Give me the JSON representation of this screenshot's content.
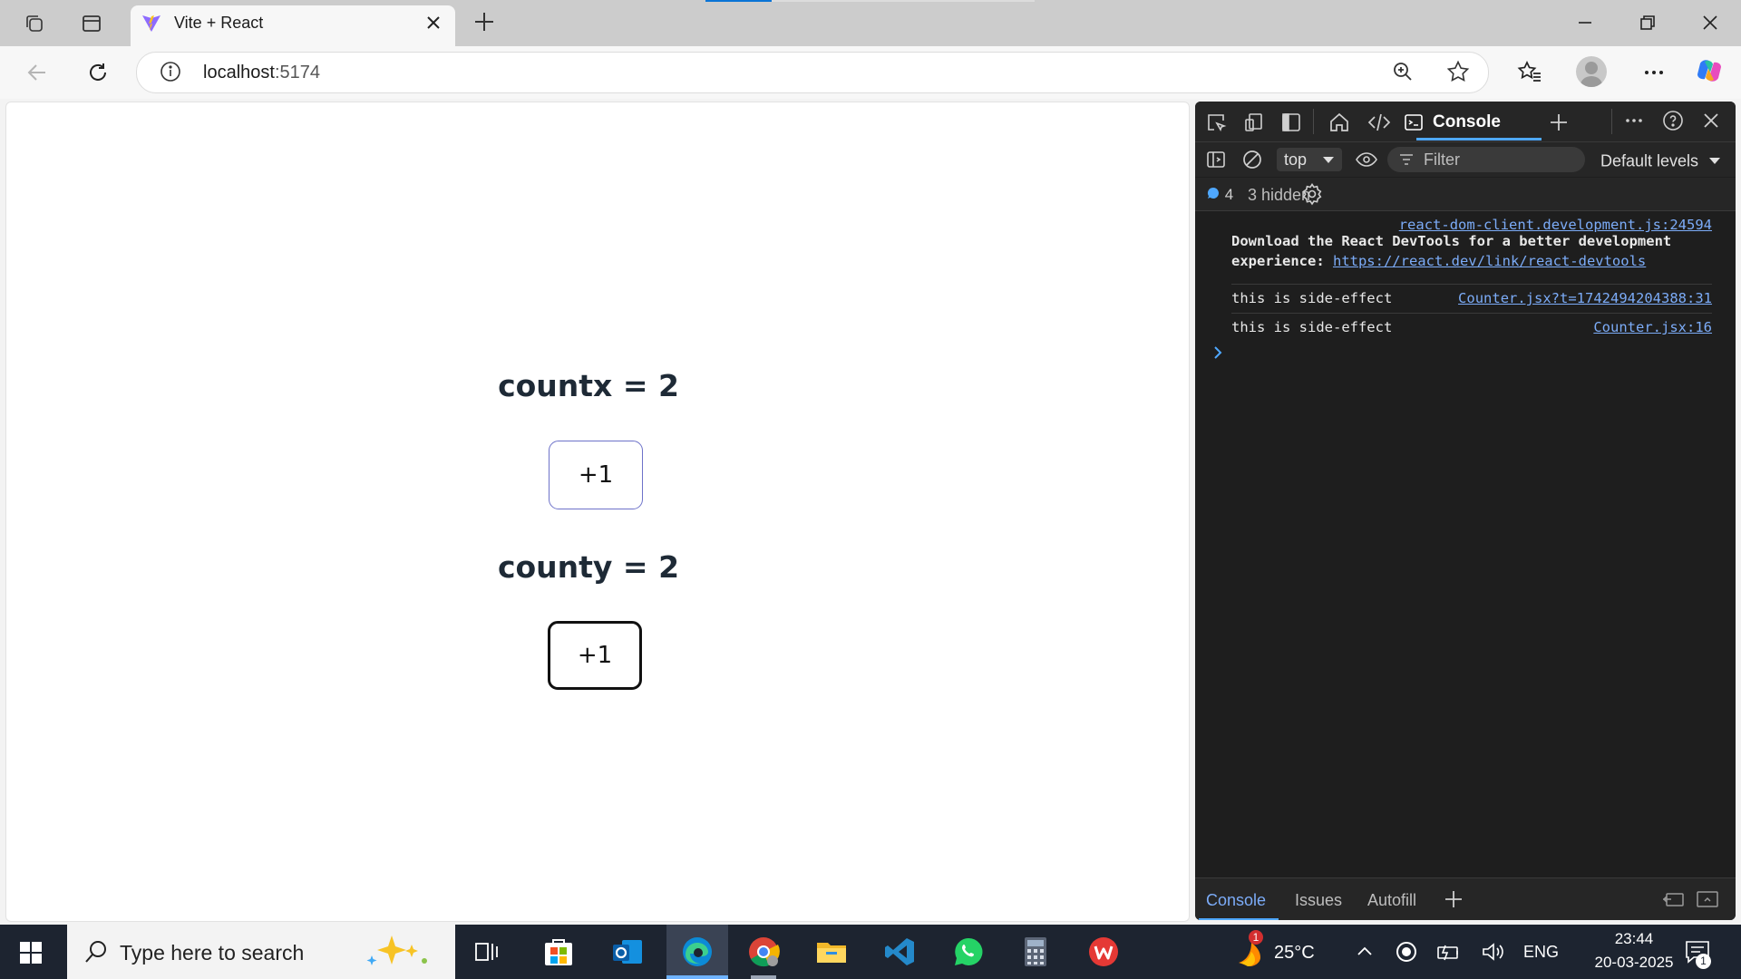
{
  "browser": {
    "tab": {
      "title": "Vite + React"
    },
    "address": {
      "host": "localhost",
      "port": ":5174"
    }
  },
  "page": {
    "countx": {
      "label": "countx = 2",
      "button": "+1"
    },
    "county": {
      "label": "county = 2",
      "button": "+1"
    }
  },
  "devtools": {
    "active_tab": "Console",
    "context": "top",
    "filter_placeholder": "Filter",
    "levels": "Default levels",
    "message_count": "4",
    "hidden": "3 hidden",
    "logs": [
      {
        "source": "react-dom-client.development.js:24594",
        "line1": "Download the React DevTools for a better development",
        "line2_prefix": "experience: ",
        "link": "https://react.dev/link/react-devtools"
      },
      {
        "text": "this is side-effect",
        "source": "Counter.jsx?t=1742494204388:31"
      },
      {
        "text": "this is side-effect",
        "source": "Counter.jsx:16"
      }
    ],
    "drawer_tabs": [
      "Console",
      "Issues",
      "Autofill"
    ]
  },
  "taskbar": {
    "search_placeholder": "Type here to search",
    "weather": "25°C",
    "weather_badge": "1",
    "language": "ENG",
    "time": "23:44",
    "date": "20-03-2025",
    "notification_count": "1"
  }
}
